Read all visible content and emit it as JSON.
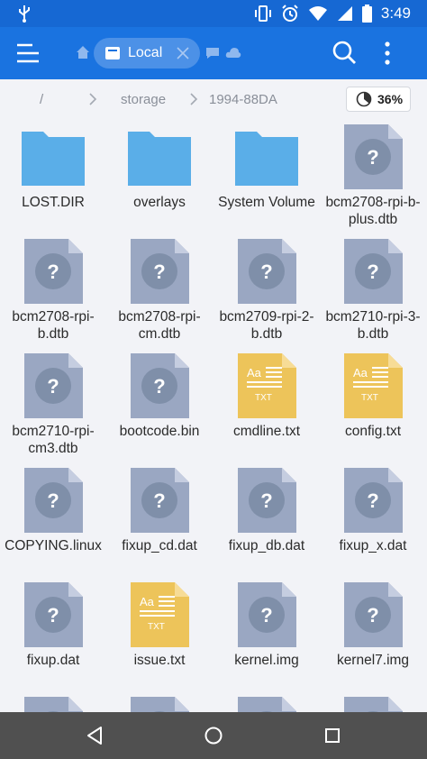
{
  "status_bar": {
    "time": "3:49",
    "icons": [
      "usb-icon",
      "vibrate-icon",
      "alarm-icon",
      "wifi-icon",
      "signal-icon",
      "battery-icon"
    ]
  },
  "app_bar": {
    "tab_label": "Local",
    "icons": [
      "menu-icon",
      "home-icon",
      "drive-icon",
      "close-icon",
      "chat-icon",
      "cloud-icon",
      "search-icon",
      "more-vert-icon"
    ]
  },
  "breadcrumb": {
    "segments": [
      "/",
      "storage",
      "1994-88DA"
    ],
    "storage_usage": "36%",
    "storage_usage_value": 36
  },
  "files": [
    {
      "name": "LOST.DIR",
      "type": "folder"
    },
    {
      "name": "overlays",
      "type": "folder"
    },
    {
      "name": "System Volume",
      "type": "folder"
    },
    {
      "name": "bcm2708-rpi-b-plus.dtb",
      "type": "unknown"
    },
    {
      "name": "bcm2708-rpi-b.dtb",
      "type": "unknown"
    },
    {
      "name": "bcm2708-rpi-cm.dtb",
      "type": "unknown"
    },
    {
      "name": "bcm2709-rpi-2-b.dtb",
      "type": "unknown"
    },
    {
      "name": "bcm2710-rpi-3-b.dtb",
      "type": "unknown"
    },
    {
      "name": "bcm2710-rpi-cm3.dtb",
      "type": "unknown"
    },
    {
      "name": "bootcode.bin",
      "type": "unknown"
    },
    {
      "name": "cmdline.txt",
      "type": "text"
    },
    {
      "name": "config.txt",
      "type": "text"
    },
    {
      "name": "COPYING.linux",
      "type": "unknown"
    },
    {
      "name": "fixup_cd.dat",
      "type": "unknown"
    },
    {
      "name": "fixup_db.dat",
      "type": "unknown"
    },
    {
      "name": "fixup_x.dat",
      "type": "unknown"
    },
    {
      "name": "fixup.dat",
      "type": "unknown"
    },
    {
      "name": "issue.txt",
      "type": "text"
    },
    {
      "name": "kernel.img",
      "type": "unknown"
    },
    {
      "name": "kernel7.img",
      "type": "unknown"
    }
  ],
  "file_icons": {
    "unknown_glyph": "?",
    "text_badge_top": "Aa",
    "text_badge_bottom": "TXT"
  },
  "colors": {
    "app_bar": "#1a73e0",
    "status_bar": "#1668d3",
    "folder": "#5aaee8",
    "unknown_file": "#9aa7c2",
    "text_file": "#edc45a",
    "nav_bar": "#505050"
  },
  "nav_bar": {
    "icons": [
      "back-icon",
      "home-circle-icon",
      "recents-icon"
    ]
  }
}
